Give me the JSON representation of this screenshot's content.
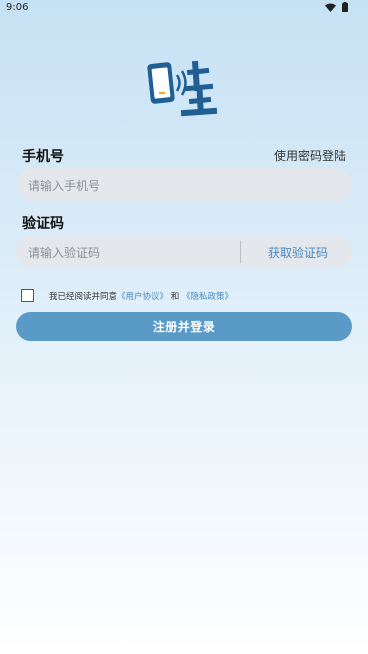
{
  "status_bar": {
    "time": "9:06",
    "icons": [
      "wifi-icon",
      "battery-icon"
    ]
  },
  "logo": {
    "text": "哇",
    "colors": {
      "primary": "#1f5f94",
      "accent": "#f3a31b"
    }
  },
  "form": {
    "phone_label": "手机号",
    "password_login_link": "使用密码登陆",
    "phone_placeholder": "请输入手机号",
    "code_label": "验证码",
    "code_placeholder": "请输入验证码",
    "get_code_button": "获取验证码"
  },
  "agreement": {
    "prefix": "我已经阅读并同意",
    "user_agreement": "《用户协议》",
    "conjunction": "和",
    "privacy_policy": "《隐私政策》",
    "checked": false
  },
  "submit_button": "注册并登录",
  "colors": {
    "accent": "#5a9ac7",
    "link": "#4a87c0",
    "field_bg": "#e4e8ec"
  }
}
